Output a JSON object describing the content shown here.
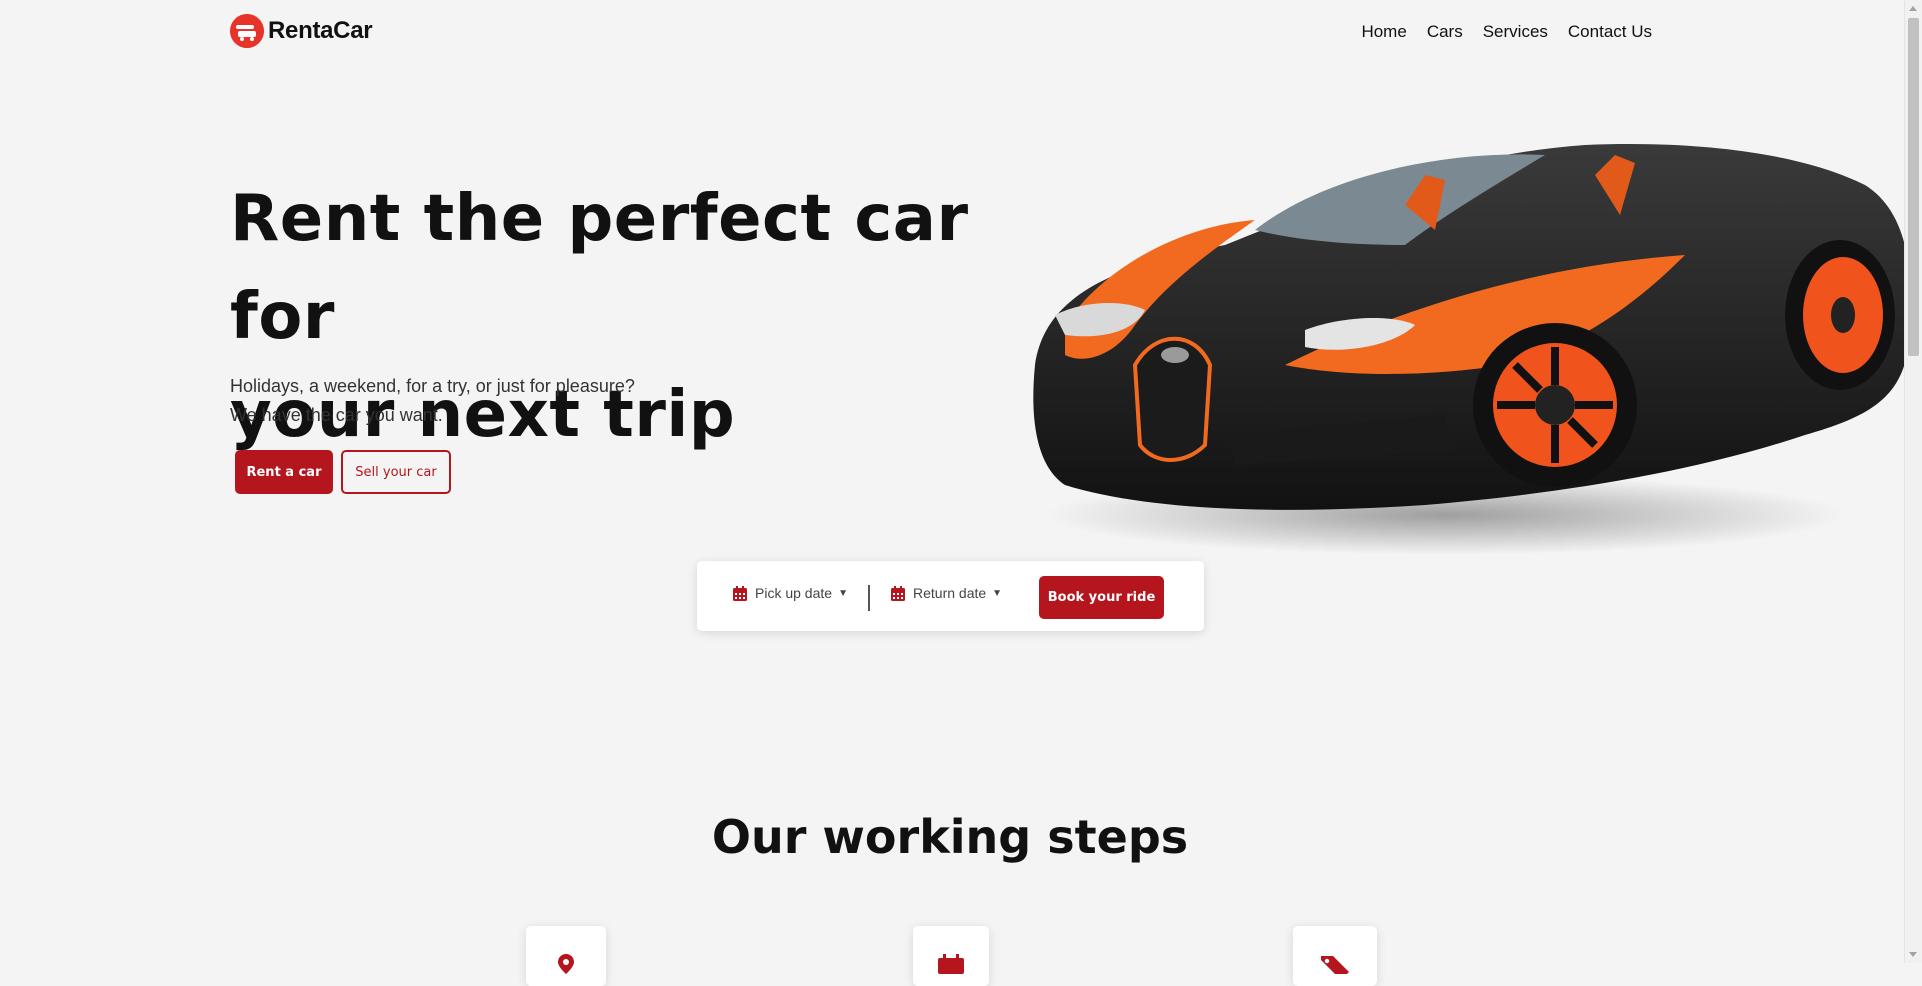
{
  "header": {
    "brand": "RentaCar",
    "nav": [
      {
        "label": "Home"
      },
      {
        "label": "Cars"
      },
      {
        "label": "Services"
      },
      {
        "label": "Contact Us"
      }
    ]
  },
  "hero": {
    "title_line1": "Rent the perfect car for",
    "title_line2": "your next trip",
    "subtitle_line1": "Holidays, a weekend, for a try, or just for pleasure?",
    "subtitle_line2": "We have the car you want.",
    "rent_button": "Rent a car",
    "sell_button": "Sell your car"
  },
  "booking": {
    "pickup_label": "Pick up date",
    "return_label": "Return date",
    "book_button": "Book your ride"
  },
  "steps": {
    "title": "Our working steps",
    "icons": [
      "location-pin-icon",
      "calendar-icon",
      "tag-icon"
    ]
  },
  "colors": {
    "accent": "#b5161d",
    "logo": "#e8332a",
    "background": "#f4f4f4"
  }
}
